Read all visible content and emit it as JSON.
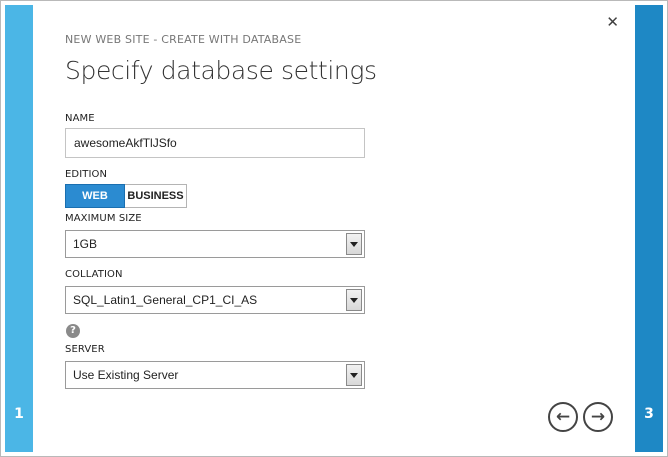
{
  "wizard": {
    "breadcrumb": "NEW WEB SITE - CREATE WITH DATABASE",
    "title": "Specify database settings",
    "close_icon": "close-icon",
    "step_left": "1",
    "step_right": "3"
  },
  "fields": {
    "name_label": "NAME",
    "name_value": "awesomeAkfTlJSfo",
    "edition_label": "EDITION",
    "edition_options": [
      "WEB",
      "BUSINESS"
    ],
    "edition_selected": "WEB",
    "max_size_label": "MAXIMUM SIZE",
    "max_size_value": "1GB",
    "collation_label": "COLLATION",
    "collation_value": "SQL_Latin1_General_CP1_CI_AS",
    "help_glyph": "?",
    "server_label": "SERVER",
    "server_value": "Use Existing Server"
  },
  "nav": {
    "back_glyph": "←",
    "next_glyph": "→"
  },
  "colors": {
    "left_rail": "#4bb6e6",
    "right_rail": "#1e88c5",
    "toggle_active": "#2b8bd1"
  }
}
